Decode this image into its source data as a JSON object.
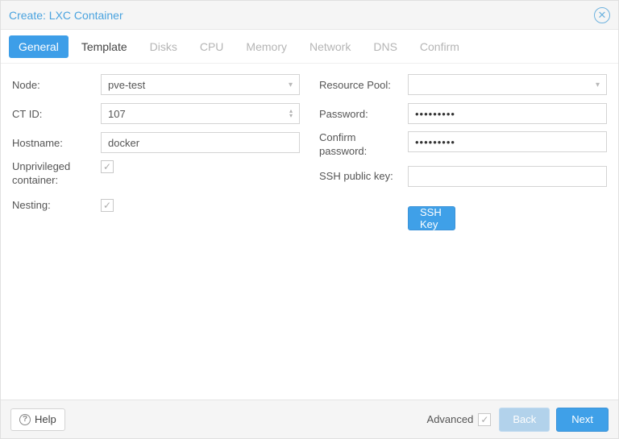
{
  "title": "Create: LXC Container",
  "tabs": [
    {
      "label": "General",
      "state": "active"
    },
    {
      "label": "Template",
      "state": "enabled"
    },
    {
      "label": "Disks",
      "state": "disabled"
    },
    {
      "label": "CPU",
      "state": "disabled"
    },
    {
      "label": "Memory",
      "state": "disabled"
    },
    {
      "label": "Network",
      "state": "disabled"
    },
    {
      "label": "DNS",
      "state": "disabled"
    },
    {
      "label": "Confirm",
      "state": "disabled"
    }
  ],
  "left": {
    "node_label": "Node:",
    "node_value": "pve-test",
    "ctid_label": "CT ID:",
    "ctid_value": "107",
    "hostname_label": "Hostname:",
    "hostname_value": "docker",
    "unpriv_label": "Unprivileged container:",
    "unpriv_checked": true,
    "nesting_label": "Nesting:",
    "nesting_checked": true
  },
  "right": {
    "pool_label": "Resource Pool:",
    "pool_value": "",
    "pw_label": "Password:",
    "pw_value": "•••••••••",
    "confirm_label": "Confirm password:",
    "confirm_value": "•••••••••",
    "ssh_label": "SSH public key:",
    "ssh_value": "",
    "load_ssh_btn": "Load SSH Key File"
  },
  "footer": {
    "help": "Help",
    "advanced": "Advanced",
    "advanced_checked": true,
    "back": "Back",
    "next": "Next"
  }
}
